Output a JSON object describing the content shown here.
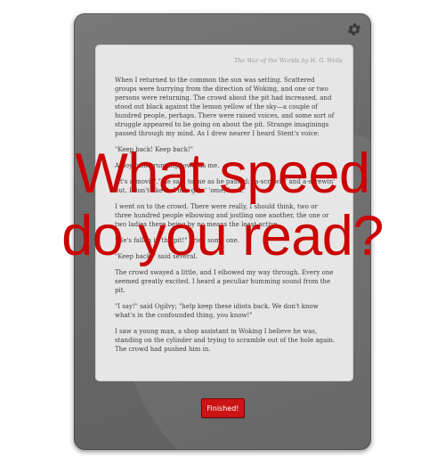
{
  "device": {
    "settings_icon": "gear-icon",
    "book_header": "The War of the Worlds by H. G. Wells",
    "paragraphs": [
      "When I returned to the common the sun was setting. Scattered groups were hurrying from the direction of Woking, and one or two persons were returning. The crowd about the pit had increased, and stood out black against the lemon yellow of the sky—a couple of hundred people, perhaps. There were raised voices, and some sort of struggle appeared to be going on about the pit. Strange imaginings passed through my mind. As I drew nearer I heard Stent's voice:",
      "\"Keep back! Keep back!\"",
      "A boy came running towards me.",
      "\"It's a-movin',\" he said to me as he passed; \"a-screwin' and a-screwin' out. I don't like it. I'm a-goin' 'ome, I am.\"",
      "I went on to the crowd. There were really, I should think, two or three hundred people elbowing and jostling one another, the one or two ladies there being by no means the least active.",
      "\"He's fallen in the pit!\" cried some one.",
      "\"Keep back!\" said several.",
      "The crowd swayed a little, and I elbowed my way through. Every one seemed greatly excited. I heard a peculiar humming sound from the pit.",
      "\"I say!\" said Ogilvy; \"help keep these idiots back. We don't know what's in the confounded thing, you know!\"",
      "I saw a young man, a shop assistant in Woking I believe he was, standing on the cylinder and trying to scramble out of the hole again. The crowd had pushed him in."
    ],
    "finish_label": "Finished!"
  },
  "overlay": {
    "line1": "What speed",
    "line2": "do you read?",
    "color": "#cc0000"
  }
}
